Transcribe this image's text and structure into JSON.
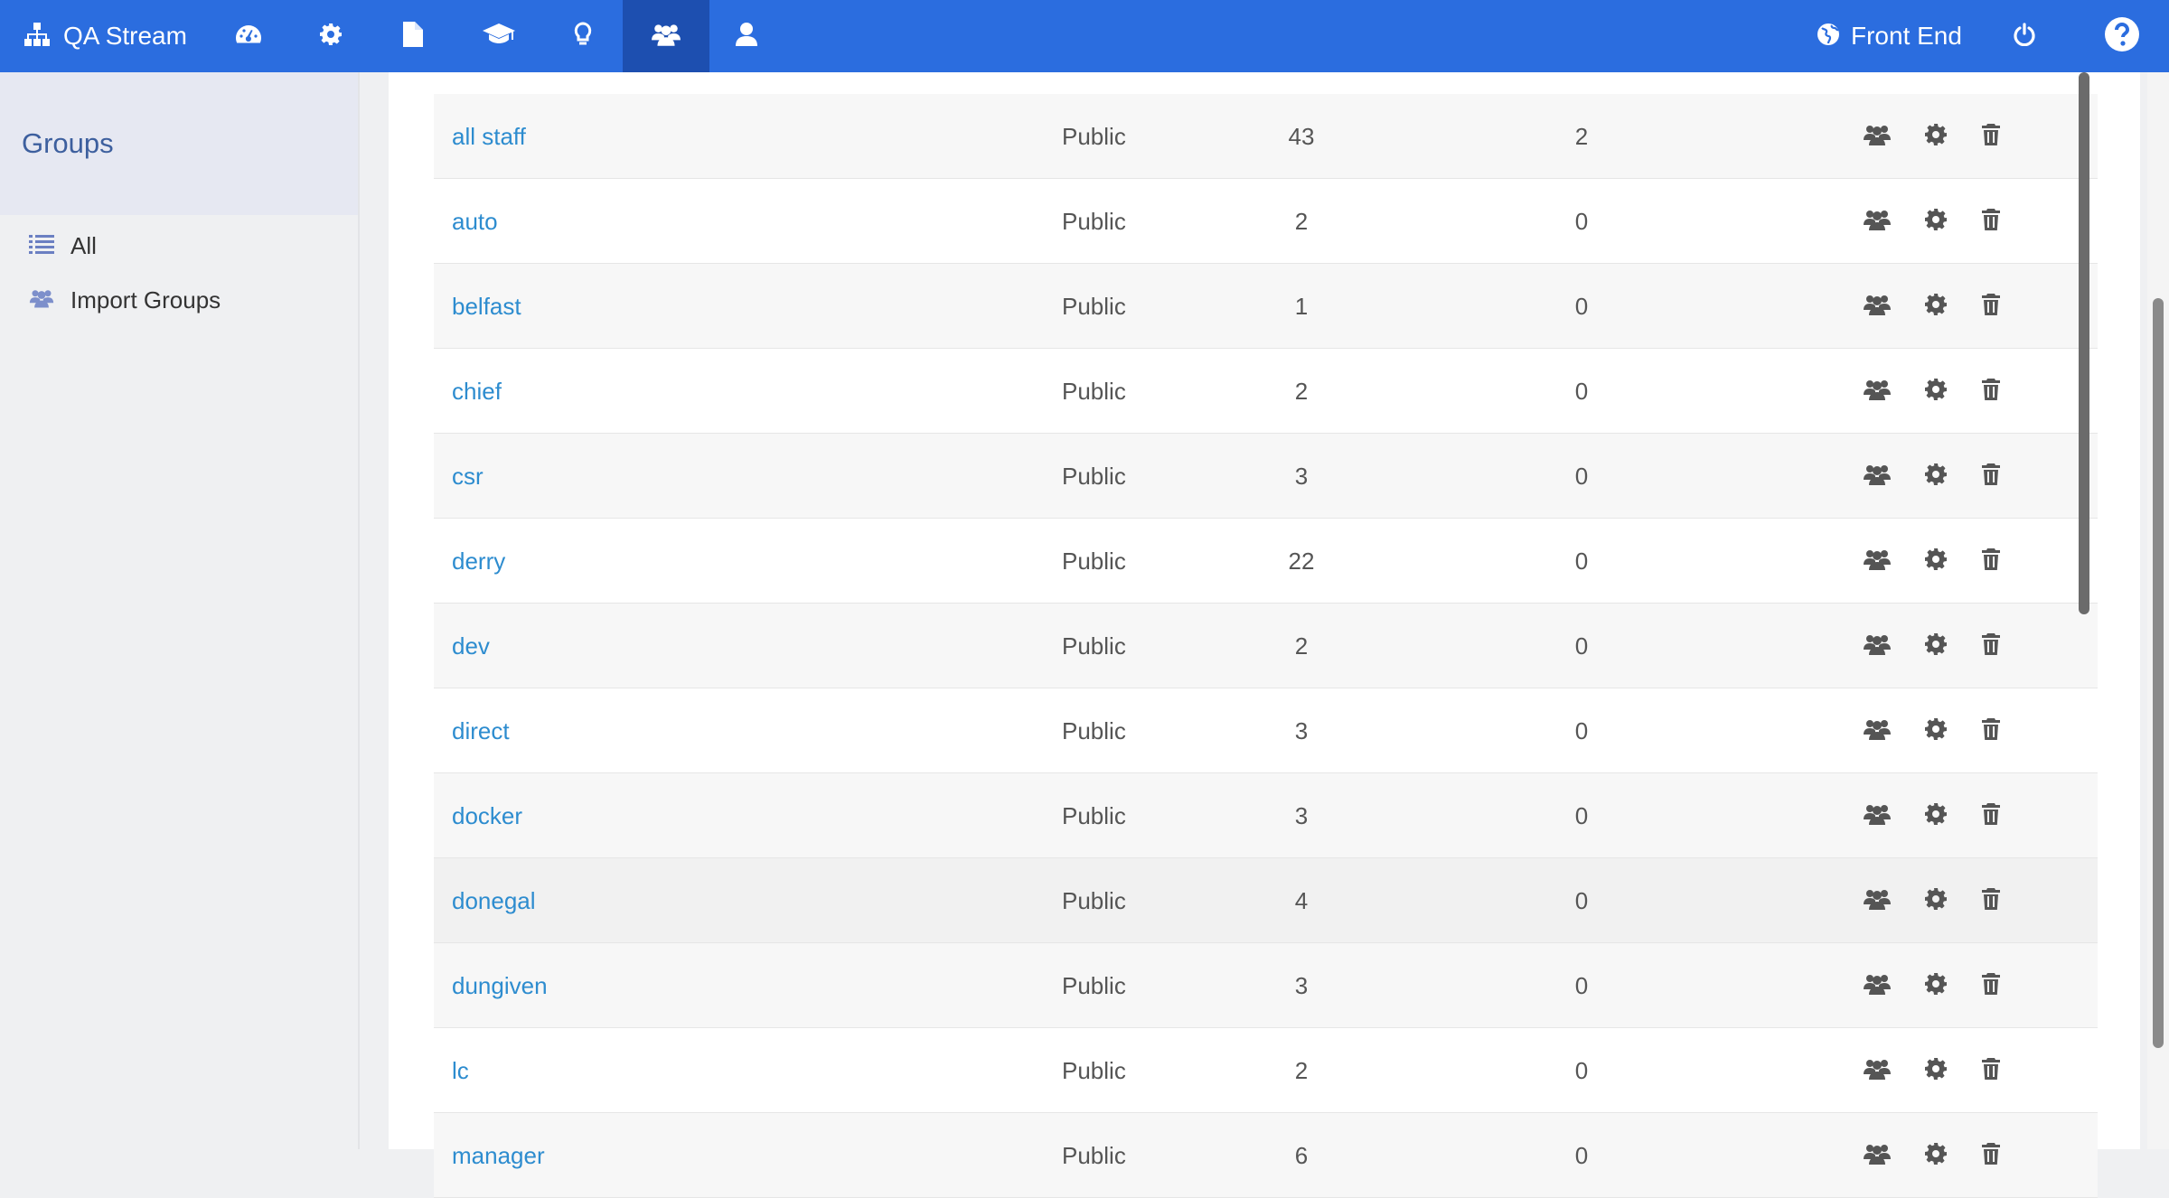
{
  "app": {
    "name": "QA Stream"
  },
  "topbar": {
    "nav": [
      {
        "icon": "dashboard-icon",
        "active": false
      },
      {
        "icon": "gear-icon",
        "active": false
      },
      {
        "icon": "file-icon",
        "active": false
      },
      {
        "icon": "graduation-cap-icon",
        "active": false
      },
      {
        "icon": "lightbulb-icon",
        "active": false
      },
      {
        "icon": "users-icon",
        "active": true
      },
      {
        "icon": "user-icon",
        "active": false
      }
    ],
    "front_end_label": "Front End"
  },
  "sidebar": {
    "title": "Groups",
    "items": [
      {
        "label": "All",
        "icon": "list-icon"
      },
      {
        "label": "Import Groups",
        "icon": "users-icon"
      }
    ]
  },
  "table": {
    "rows": [
      {
        "name": "all staff",
        "type": "Public",
        "members": "43",
        "count": "2"
      },
      {
        "name": "auto",
        "type": "Public",
        "members": "2",
        "count": "0"
      },
      {
        "name": "belfast",
        "type": "Public",
        "members": "1",
        "count": "0"
      },
      {
        "name": "chief",
        "type": "Public",
        "members": "2",
        "count": "0"
      },
      {
        "name": "csr",
        "type": "Public",
        "members": "3",
        "count": "0"
      },
      {
        "name": "derry",
        "type": "Public",
        "members": "22",
        "count": "0"
      },
      {
        "name": "dev",
        "type": "Public",
        "members": "2",
        "count": "0"
      },
      {
        "name": "direct",
        "type": "Public",
        "members": "3",
        "count": "0"
      },
      {
        "name": "docker",
        "type": "Public",
        "members": "3",
        "count": "0"
      },
      {
        "name": "donegal",
        "type": "Public",
        "members": "4",
        "count": "0"
      },
      {
        "name": "dungiven",
        "type": "Public",
        "members": "3",
        "count": "0"
      },
      {
        "name": "lc",
        "type": "Public",
        "members": "2",
        "count": "0"
      },
      {
        "name": "manager",
        "type": "Public",
        "members": "6",
        "count": "0"
      }
    ],
    "row_actions": [
      "users-icon",
      "gear-icon",
      "trash-icon"
    ]
  },
  "colors": {
    "topbar": "#2b6ddf",
    "topbar_active": "#1d4fb0",
    "link": "#2d8ccf",
    "sidebar_title": "#3d5f9e"
  }
}
